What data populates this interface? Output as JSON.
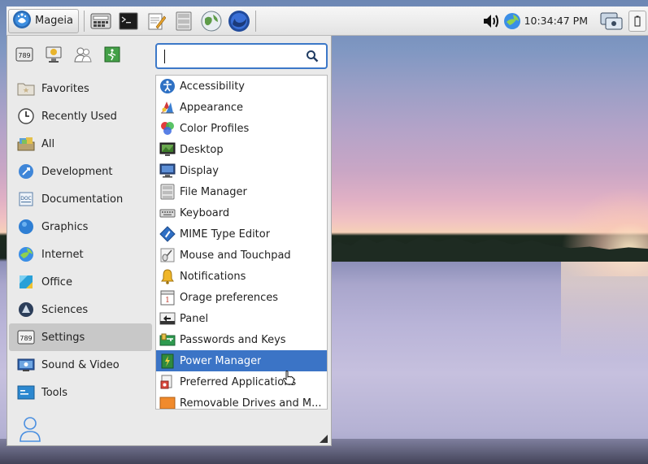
{
  "panel": {
    "menu_label": "Mageia",
    "clock": "10:34:47 PM",
    "launchers": [
      "calculator-icon",
      "terminal-icon",
      "text-editor-icon",
      "file-manager-icon",
      "web-browser-icon",
      "firefox-icon"
    ]
  },
  "search": {
    "value": "",
    "placeholder": ""
  },
  "favorites_bar": [
    "settings-icon",
    "screensaver-icon",
    "users-icon",
    "logout-icon"
  ],
  "categories": [
    {
      "label": "Favorites",
      "icon": "favorites-folder-icon"
    },
    {
      "label": "Recently Used",
      "icon": "clock-icon"
    },
    {
      "label": "All",
      "icon": "all-apps-icon"
    },
    {
      "label": "Development",
      "icon": "development-icon"
    },
    {
      "label": "Documentation",
      "icon": "documentation-icon"
    },
    {
      "label": "Graphics",
      "icon": "graphics-icon"
    },
    {
      "label": "Internet",
      "icon": "internet-icon"
    },
    {
      "label": "Office",
      "icon": "office-icon"
    },
    {
      "label": "Sciences",
      "icon": "sciences-icon"
    },
    {
      "label": "Settings",
      "icon": "settings-icon"
    },
    {
      "label": "Sound & Video",
      "icon": "sound-video-icon"
    },
    {
      "label": "Tools",
      "icon": "tools-icon"
    }
  ],
  "selected_category": "Settings",
  "apps": [
    {
      "label": "Accessibility",
      "icon": "accessibility-icon"
    },
    {
      "label": "Appearance",
      "icon": "appearance-icon"
    },
    {
      "label": "Color Profiles",
      "icon": "color-profiles-icon"
    },
    {
      "label": "Desktop",
      "icon": "desktop-icon"
    },
    {
      "label": "Display",
      "icon": "display-icon"
    },
    {
      "label": "File Manager",
      "icon": "file-manager-icon"
    },
    {
      "label": "Keyboard",
      "icon": "keyboard-icon"
    },
    {
      "label": "MIME Type Editor",
      "icon": "mime-editor-icon"
    },
    {
      "label": "Mouse and Touchpad",
      "icon": "mouse-icon"
    },
    {
      "label": "Notifications",
      "icon": "notification-bell-icon"
    },
    {
      "label": "Orage preferences",
      "icon": "calendar-icon"
    },
    {
      "label": "Panel",
      "icon": "panel-icon"
    },
    {
      "label": "Passwords and Keys",
      "icon": "keys-icon"
    },
    {
      "label": "Power Manager",
      "icon": "power-manager-icon"
    },
    {
      "label": "Preferred Applications",
      "icon": "preferred-apps-icon"
    },
    {
      "label": "Removable Drives and M...",
      "icon": "removable-drives-icon"
    }
  ],
  "highlighted_app": "Power Manager",
  "colors": {
    "selection": "#3b74c6",
    "search_border": "#3c78c8",
    "menu_bg": "#eaeaea"
  }
}
